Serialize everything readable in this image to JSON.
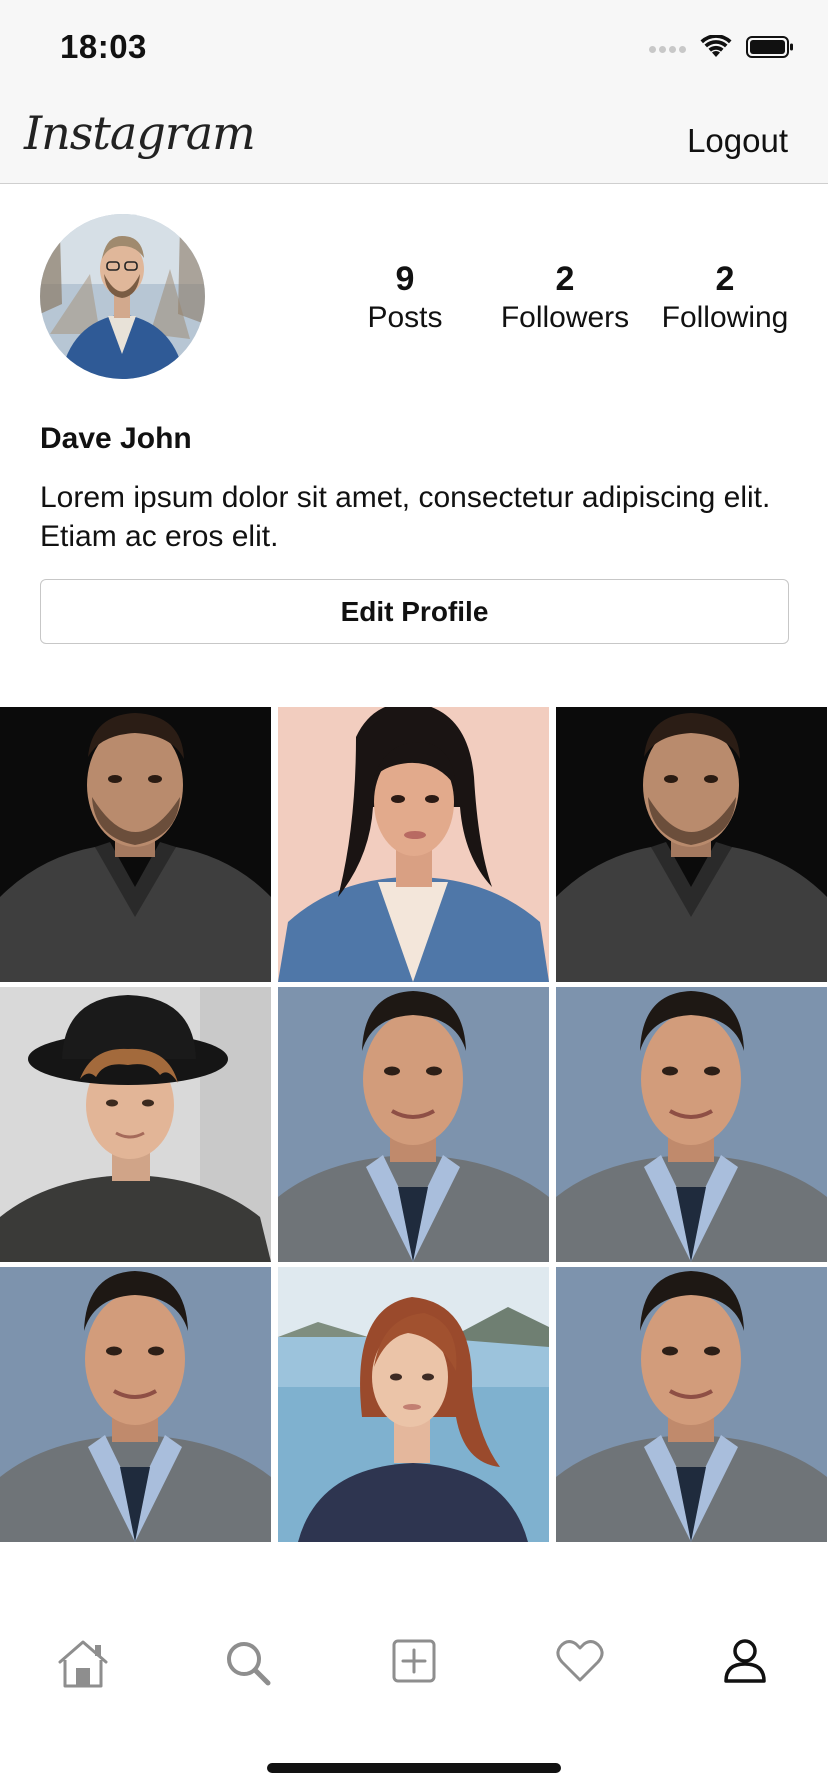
{
  "status_bar": {
    "time": "18:03"
  },
  "nav": {
    "logo": "Instagram",
    "logout_label": "Logout"
  },
  "profile": {
    "name": "Dave John",
    "bio": "Lorem ipsum dolor sit amet, consectetur adipiscing elit. Etiam ac eros elit.",
    "edit_label": "Edit Profile",
    "stats": [
      {
        "value": "9",
        "label": "Posts"
      },
      {
        "value": "2",
        "label": "Followers"
      },
      {
        "value": "2",
        "label": "Following"
      }
    ]
  },
  "posts": [
    {
      "subject": "man-dark-sweater"
    },
    {
      "subject": "woman-denim-jacket"
    },
    {
      "subject": "man-dark-sweater"
    },
    {
      "subject": "young-man-black-hat"
    },
    {
      "subject": "man-grey-sweater"
    },
    {
      "subject": "man-grey-sweater"
    },
    {
      "subject": "man-grey-sweater"
    },
    {
      "subject": "woman-red-hair"
    },
    {
      "subject": "man-grey-sweater"
    }
  ],
  "tabs": [
    {
      "icon": "home-icon",
      "selected": false
    },
    {
      "icon": "search-icon",
      "selected": false
    },
    {
      "icon": "add-post-icon",
      "selected": false
    },
    {
      "icon": "heart-icon",
      "selected": false
    },
    {
      "icon": "profile-icon",
      "selected": true
    }
  ],
  "colors": {
    "bar_bg": "#f7f7f7",
    "active_tab": "#111111",
    "inactive_tab": "#8e8e8e",
    "divider": "#cfcfcf"
  }
}
